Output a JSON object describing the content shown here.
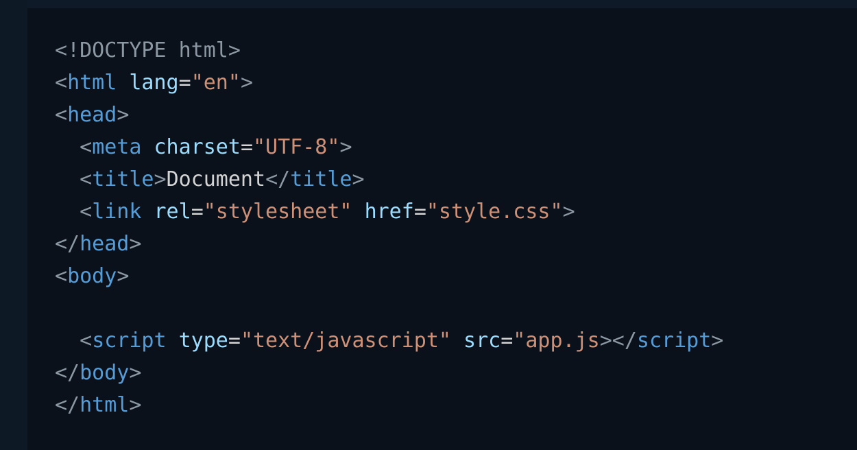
{
  "colors": {
    "background": "#0a111a",
    "punctuation": "#8c98a4",
    "tag": "#569cd6",
    "attribute": "#9cdcfe",
    "string": "#ce9178",
    "text": "#d4d4d4"
  },
  "code": {
    "lines": [
      [
        {
          "type": "doc",
          "text": "<!DOCTYPE html>"
        }
      ],
      [
        {
          "type": "punct",
          "text": "<"
        },
        {
          "type": "tag",
          "text": "html"
        },
        {
          "type": "text",
          "text": " "
        },
        {
          "type": "attr",
          "text": "lang"
        },
        {
          "type": "eq",
          "text": "="
        },
        {
          "type": "str",
          "text": "\"en\""
        },
        {
          "type": "punct",
          "text": ">"
        }
      ],
      [
        {
          "type": "punct",
          "text": "<"
        },
        {
          "type": "tag",
          "text": "head"
        },
        {
          "type": "punct",
          "text": ">"
        }
      ],
      [
        {
          "type": "text",
          "text": "  "
        },
        {
          "type": "punct",
          "text": "<"
        },
        {
          "type": "tag",
          "text": "meta"
        },
        {
          "type": "text",
          "text": " "
        },
        {
          "type": "attr",
          "text": "charset"
        },
        {
          "type": "eq",
          "text": "="
        },
        {
          "type": "str",
          "text": "\"UTF-8\""
        },
        {
          "type": "punct",
          "text": ">"
        }
      ],
      [
        {
          "type": "text",
          "text": "  "
        },
        {
          "type": "punct",
          "text": "<"
        },
        {
          "type": "tag",
          "text": "title"
        },
        {
          "type": "punct",
          "text": ">"
        },
        {
          "type": "text",
          "text": "Document"
        },
        {
          "type": "punct",
          "text": "</"
        },
        {
          "type": "tag",
          "text": "title"
        },
        {
          "type": "punct",
          "text": ">"
        }
      ],
      [
        {
          "type": "text",
          "text": "  "
        },
        {
          "type": "punct",
          "text": "<"
        },
        {
          "type": "tag",
          "text": "link"
        },
        {
          "type": "text",
          "text": " "
        },
        {
          "type": "attr",
          "text": "rel"
        },
        {
          "type": "eq",
          "text": "="
        },
        {
          "type": "str",
          "text": "\"stylesheet\""
        },
        {
          "type": "text",
          "text": " "
        },
        {
          "type": "attr",
          "text": "href"
        },
        {
          "type": "eq",
          "text": "="
        },
        {
          "type": "str",
          "text": "\"style.css\""
        },
        {
          "type": "punct",
          "text": ">"
        }
      ],
      [
        {
          "type": "punct",
          "text": "</"
        },
        {
          "type": "tag",
          "text": "head"
        },
        {
          "type": "punct",
          "text": ">"
        }
      ],
      [
        {
          "type": "punct",
          "text": "<"
        },
        {
          "type": "tag",
          "text": "body"
        },
        {
          "type": "punct",
          "text": ">"
        }
      ],
      [],
      [
        {
          "type": "text",
          "text": "  "
        },
        {
          "type": "punct",
          "text": "<"
        },
        {
          "type": "tag",
          "text": "script"
        },
        {
          "type": "text",
          "text": " "
        },
        {
          "type": "attr",
          "text": "type"
        },
        {
          "type": "eq",
          "text": "="
        },
        {
          "type": "str",
          "text": "\"text/javascript\""
        },
        {
          "type": "text",
          "text": " "
        },
        {
          "type": "attr",
          "text": "src"
        },
        {
          "type": "eq",
          "text": "="
        },
        {
          "type": "str",
          "text": "\"app.js"
        },
        {
          "type": "punct",
          "text": "></"
        },
        {
          "type": "tag",
          "text": "script"
        },
        {
          "type": "punct",
          "text": ">"
        }
      ],
      [
        {
          "type": "punct",
          "text": "</"
        },
        {
          "type": "tag",
          "text": "body"
        },
        {
          "type": "punct",
          "text": ">"
        }
      ],
      [
        {
          "type": "punct",
          "text": "</"
        },
        {
          "type": "tag",
          "text": "html"
        },
        {
          "type": "punct",
          "text": ">"
        }
      ]
    ]
  }
}
